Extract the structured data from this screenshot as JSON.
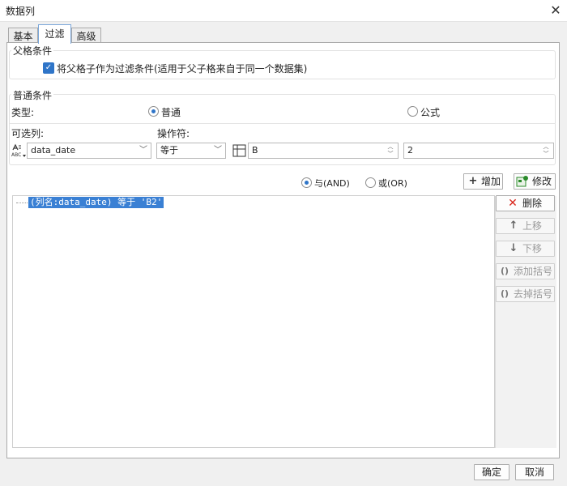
{
  "window": {
    "title": "数据列",
    "close_glyph": "✕"
  },
  "tabs": [
    {
      "label": "基本"
    },
    {
      "label": "过滤"
    },
    {
      "label": "高级"
    }
  ],
  "parent_condition": {
    "group_title": "父格条件",
    "checkbox_label": "将父格子作为过滤条件(适用于父子格来自于同一个数据集)",
    "checked": true
  },
  "normal_condition": {
    "group_title": "普通条件",
    "type_label": "类型:",
    "type_options": [
      {
        "label": "普通",
        "checked": true
      },
      {
        "label": "公式",
        "checked": false
      }
    ],
    "column_label": "可选列:",
    "operator_label": "操作符:",
    "column_value": "data_date",
    "operator_value": "等于",
    "value_field": "B",
    "value_field_2": "2"
  },
  "logic": {
    "options": [
      {
        "label": "与(AND)",
        "checked": true
      },
      {
        "label": "或(OR)",
        "checked": false
      }
    ],
    "add_label": "增加",
    "modify_label": "修改"
  },
  "conditions_list": {
    "items": [
      "(列名:data_date) 等于 'B2'"
    ]
  },
  "side_buttons": {
    "delete": "删除",
    "move_up": "上移",
    "move_down": "下移",
    "add_bracket": "添加括号",
    "remove_bracket": "去掉括号"
  },
  "footer": {
    "ok_label": "确定",
    "cancel_label": "取消"
  },
  "colors": {
    "accent": "#2f75c8",
    "selection": "#3a80d4",
    "delete_red": "#d9261c"
  }
}
